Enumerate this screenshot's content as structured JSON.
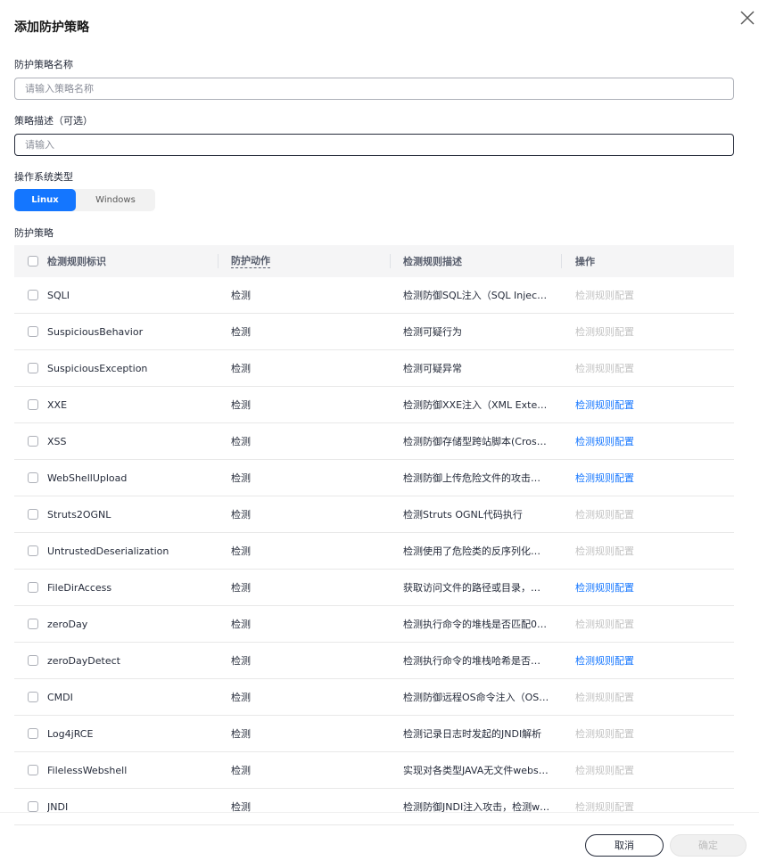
{
  "dialog": {
    "title": "添加防护策略",
    "close_icon": "close-icon"
  },
  "form": {
    "name_label": "防护策略名称",
    "name_placeholder": "请输入策略名称",
    "name_value": "",
    "desc_label": "策略描述（可选）",
    "desc_placeholder": "请输入",
    "desc_value": "",
    "os_label": "操作系统类型",
    "os_options": [
      "Linux",
      "Windows"
    ],
    "os_selected": "Linux",
    "policy_label": "防护策略"
  },
  "table": {
    "headers": {
      "id": "检测规则标识",
      "action": "防护动作",
      "desc": "检测规则描述",
      "op": "操作"
    },
    "rows": [
      {
        "id": "SQLI",
        "action": "检测",
        "desc": "检测防御SQL注入（SQL Injecti…",
        "op": "检测规则配置",
        "op_enabled": false
      },
      {
        "id": "SuspiciousBehavior",
        "action": "检测",
        "desc": "检测可疑行为",
        "op": "检测规则配置",
        "op_enabled": false
      },
      {
        "id": "SuspiciousException",
        "action": "检测",
        "desc": "检测可疑异常",
        "op": "检测规则配置",
        "op_enabled": false
      },
      {
        "id": "XXE",
        "action": "检测",
        "desc": "检测防御XXE注入（XML Exter…",
        "op": "检测规则配置",
        "op_enabled": true
      },
      {
        "id": "XSS",
        "action": "检测",
        "desc": "检测防御存储型跨站脚本(Cross…",
        "op": "检测规则配置",
        "op_enabled": true
      },
      {
        "id": "WebShellUpload",
        "action": "检测",
        "desc": "检测防御上传危险文件的攻击…",
        "op": "检测规则配置",
        "op_enabled": true
      },
      {
        "id": "Struts2OGNL",
        "action": "检测",
        "desc": "检测Struts OGNL代码执行",
        "op": "检测规则配置",
        "op_enabled": false
      },
      {
        "id": "UntrustedDeserialization",
        "action": "检测",
        "desc": "检测使用了危险类的反序列化…",
        "op": "检测规则配置",
        "op_enabled": false
      },
      {
        "id": "FileDirAccess",
        "action": "检测",
        "desc": "获取访问文件的路径或目录，…",
        "op": "检测规则配置",
        "op_enabled": true
      },
      {
        "id": "zeroDay",
        "action": "检测",
        "desc": "检测执行命令的堆栈是否匹配0…",
        "op": "检测规则配置",
        "op_enabled": false
      },
      {
        "id": "zeroDayDetect",
        "action": "检测",
        "desc": "检测执行命令的堆栈哈希是否…",
        "op": "检测规则配置",
        "op_enabled": true
      },
      {
        "id": "CMDI",
        "action": "检测",
        "desc": "检测防御远程OS命令注入（OS…",
        "op": "检测规则配置",
        "op_enabled": false
      },
      {
        "id": "Log4jRCE",
        "action": "检测",
        "desc": "检测记录日志时发起的JNDI解析",
        "op": "检测规则配置",
        "op_enabled": false
      },
      {
        "id": "FilelessWebshell",
        "action": "检测",
        "desc": "实现对各类型JAVA无文件webs…",
        "op": "检测规则配置",
        "op_enabled": false
      },
      {
        "id": "JNDI",
        "action": "检测",
        "desc": "检测防御JNDI注入攻击，检测w…",
        "op": "检测规则配置",
        "op_enabled": false
      }
    ]
  },
  "footer": {
    "cancel_label": "取消",
    "ok_label": "确定"
  },
  "colors": {
    "accent": "#1476ff",
    "disabled_text": "#c2c2c2"
  }
}
